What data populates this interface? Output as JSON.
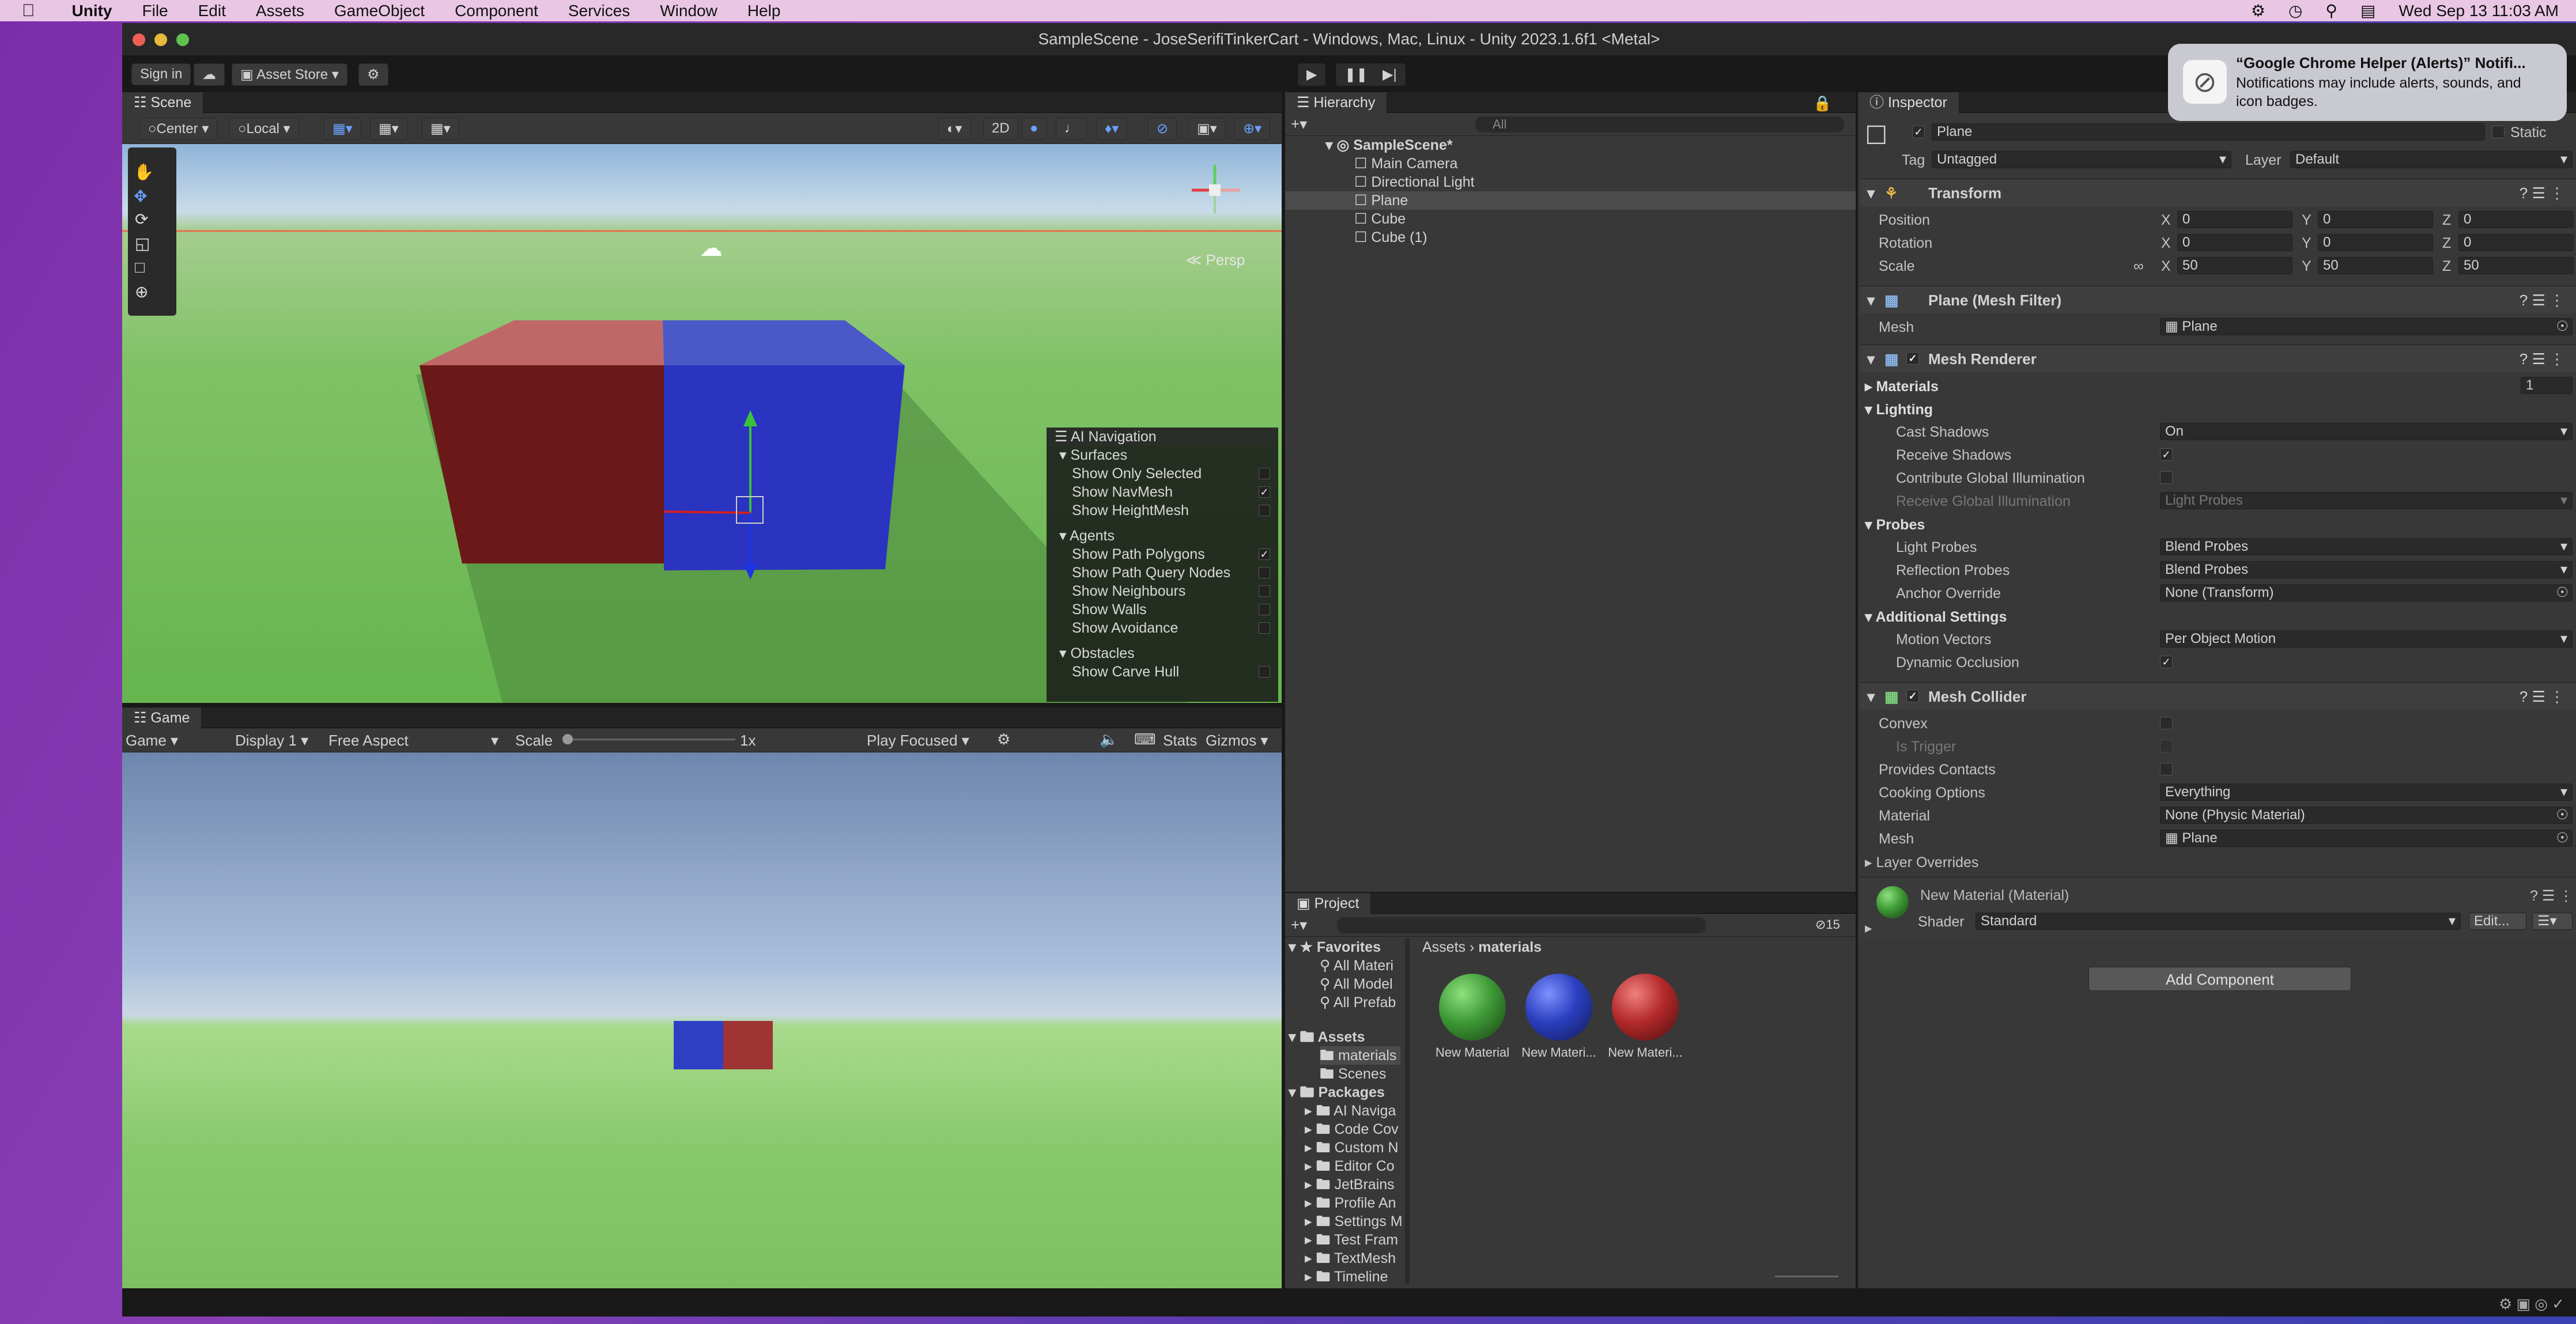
{
  "menubar": {
    "app": "Unity",
    "items": [
      "File",
      "Edit",
      "Assets",
      "GameObject",
      "Component",
      "Services",
      "Window",
      "Help"
    ],
    "clock": "Wed Sep 13  11:03 AM"
  },
  "window": {
    "title": "SampleScene - JoseSerifiTinkerCart - Windows, Mac, Linux - Unity 2023.1.6f1 <Metal>"
  },
  "toolbar": {
    "sign_in": "Sign in",
    "asset_store": "Asset Store"
  },
  "notification": {
    "title": "“Google Chrome Helper (Alerts)” Notifi...",
    "body": "Notifications may include alerts, sounds, and icon badges."
  },
  "scene": {
    "tab": "Scene",
    "pivot": "Center",
    "space": "Local",
    "mode_2d": "2D",
    "persp": "Persp"
  },
  "ai_nav": {
    "title": "AI Navigation",
    "surfaces": "Surfaces",
    "surface_items": [
      {
        "label": "Show Only Selected",
        "checked": false
      },
      {
        "label": "Show NavMesh",
        "checked": true
      },
      {
        "label": "Show HeightMesh",
        "checked": false
      }
    ],
    "agents": "Agents",
    "agent_items": [
      {
        "label": "Show Path Polygons",
        "checked": true
      },
      {
        "label": "Show Path Query Nodes",
        "checked": false
      },
      {
        "label": "Show Neighbours",
        "checked": false
      },
      {
        "label": "Show Walls",
        "checked": false
      },
      {
        "label": "Show Avoidance",
        "checked": false
      }
    ],
    "obstacles": "Obstacles",
    "obstacle_items": [
      {
        "label": "Show Carve Hull",
        "checked": false
      }
    ]
  },
  "game": {
    "tab": "Game",
    "mode": "Game",
    "display": "Display 1",
    "aspect": "Free Aspect",
    "scale_label": "Scale",
    "scale_value": "1x",
    "play_mode": "Play Focused",
    "stats": "Stats",
    "gizmos": "Gizmos"
  },
  "hierarchy": {
    "tab": "Hierarchy",
    "search": "All",
    "scene": "SampleScene*",
    "items": [
      "Main Camera",
      "Directional Light",
      "Plane",
      "Cube",
      "Cube (1)"
    ]
  },
  "project": {
    "tab": "Project",
    "favorites": "Favorites",
    "fav_items": [
      "All Materi",
      "All Model",
      "All Prefab"
    ],
    "assets": "Assets",
    "asset_items": [
      "materials",
      "Scenes"
    ],
    "packages": "Packages",
    "package_items": [
      "AI Naviga",
      "Code Cov",
      "Custom N",
      "Editor Co",
      "JetBrains",
      "Profile An",
      "Settings M",
      "Test Fram",
      "TextMesh",
      "Timeline"
    ],
    "breadcrumb": [
      "Assets",
      "materials"
    ],
    "count": "15",
    "files": [
      {
        "name": "New Material",
        "color": "#3e9a36"
      },
      {
        "name": "New Materi...",
        "color": "#2b3fbf"
      },
      {
        "name": "New Materi...",
        "color": "#b42a2a"
      }
    ]
  },
  "inspector": {
    "tab": "Inspector",
    "object": "Plane",
    "static": "Static",
    "tag_label": "Tag",
    "tag": "Untagged",
    "layer_label": "Layer",
    "layer": "Default",
    "transform": {
      "title": "Transform",
      "rows": [
        {
          "label": "Position",
          "x": "0",
          "y": "0",
          "z": "0"
        },
        {
          "label": "Rotation",
          "x": "0",
          "y": "0",
          "z": "0"
        },
        {
          "label": "Scale",
          "x": "50",
          "y": "50",
          "z": "50"
        }
      ]
    },
    "mesh_filter": {
      "title": "Plane (Mesh Filter)",
      "mesh_label": "Mesh",
      "mesh": "Plane"
    },
    "mesh_renderer": {
      "title": "Mesh Renderer",
      "materials": "Materials",
      "materials_count": "1",
      "lighting": "Lighting",
      "cast_shadows": "Cast Shadows",
      "cast_shadows_value": "On",
      "receive_shadows": "Receive Shadows",
      "contribute_gi": "Contribute Global Illumination",
      "receive_gi": "Receive Global Illumination",
      "receive_gi_value": "Light Probes",
      "probes": "Probes",
      "light_probes": "Light Probes",
      "light_probes_value": "Blend Probes",
      "reflection_probes": "Reflection Probes",
      "reflection_probes_value": "Blend Probes",
      "anchor_override": "Anchor Override",
      "anchor_override_value": "None (Transform)",
      "additional": "Additional Settings",
      "motion_vectors": "Motion Vectors",
      "motion_vectors_value": "Per Object Motion",
      "dynamic_occlusion": "Dynamic Occlusion"
    },
    "mesh_collider": {
      "title": "Mesh Collider",
      "convex": "Convex",
      "is_trigger": "Is Trigger",
      "provides_contacts": "Provides Contacts",
      "cooking": "Cooking Options",
      "cooking_value": "Everything",
      "material": "Material",
      "material_value": "None (Physic Material)",
      "mesh": "Mesh",
      "mesh_value": "Plane",
      "layer_overrides": "Layer Overrides"
    },
    "material": {
      "title": "New Material (Material)",
      "shader_label": "Shader",
      "shader": "Standard",
      "edit": "Edit..."
    },
    "add_component": "Add Component"
  },
  "colors": {
    "red_cube": "#9e3434",
    "blue_cube": "#2f3fc4",
    "ground": "#7fc266"
  }
}
